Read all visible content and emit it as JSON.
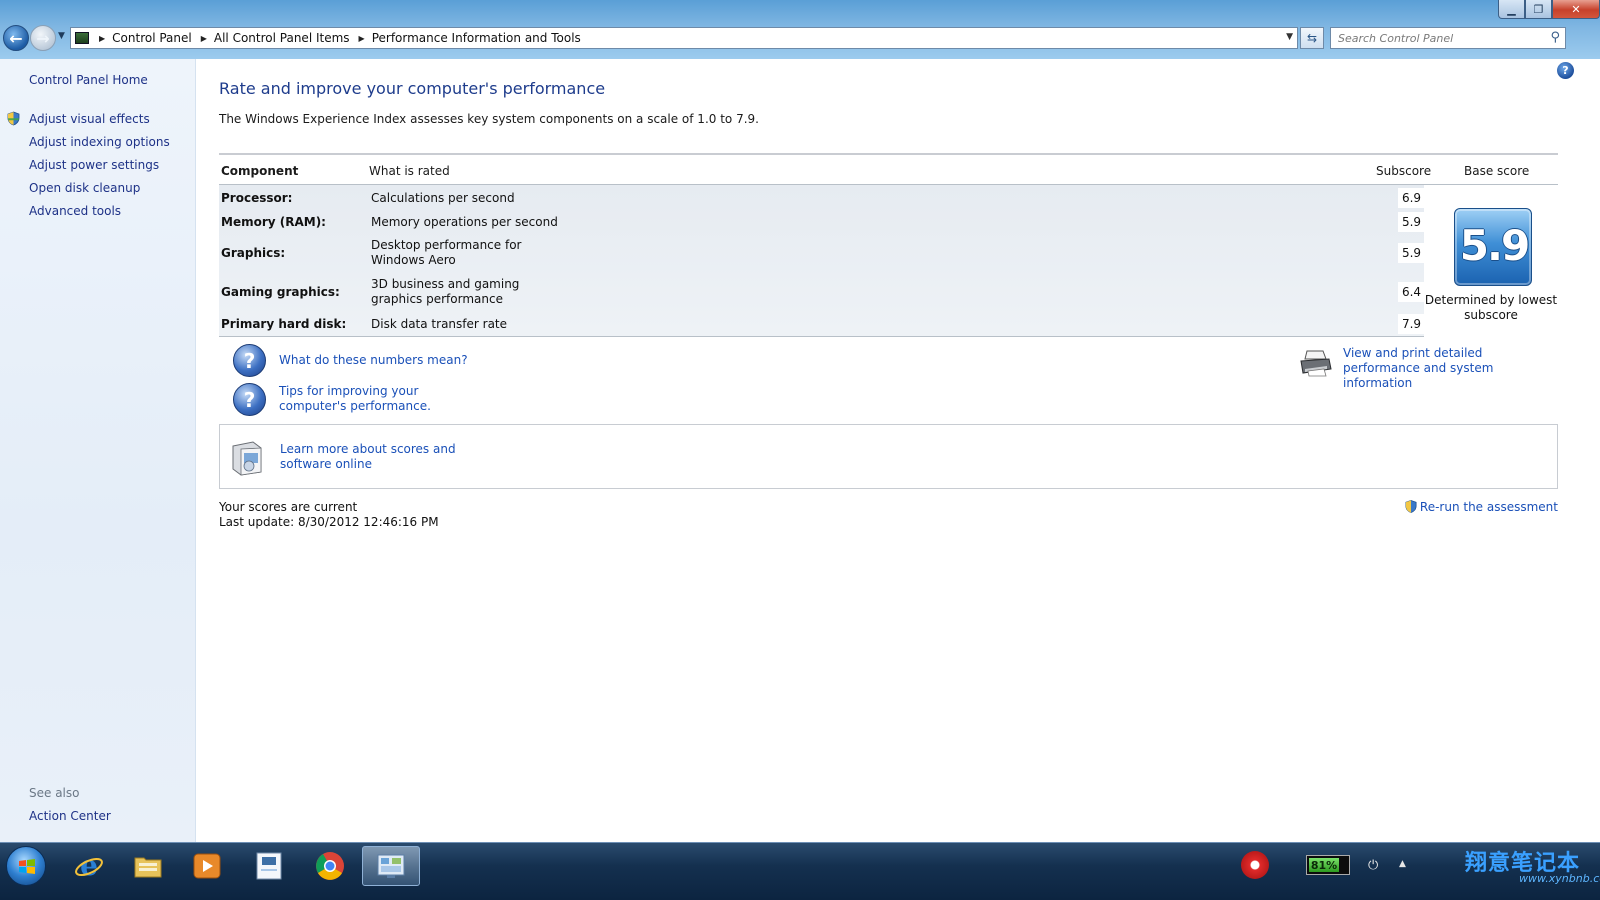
{
  "window": {
    "controls": {
      "minimize": "▁",
      "maximize": "❐",
      "close": "✕"
    }
  },
  "address": {
    "breadcrumbs": [
      "Control Panel",
      "All Control Panel Items",
      "Performance Information and Tools"
    ],
    "search_placeholder": "Search Control Panel"
  },
  "sidebar": {
    "home": "Control Panel Home",
    "tasks": [
      {
        "label": "Adjust visual effects",
        "icon": "shield-icon"
      },
      {
        "label": "Adjust indexing options"
      },
      {
        "label": "Adjust power settings"
      },
      {
        "label": "Open disk cleanup"
      },
      {
        "label": "Advanced tools"
      }
    ],
    "see_also": "See also",
    "see_also_items": [
      "Action Center"
    ]
  },
  "main": {
    "title": "Rate and improve your computer's performance",
    "description": "The Windows Experience Index assesses key system components on a scale of 1.0 to 7.9.",
    "table": {
      "headers": {
        "component": "Component",
        "what": "What is rated",
        "subscore": "Subscore",
        "base": "Base score"
      },
      "rows": [
        {
          "component": "Processor:",
          "what": "Calculations per second",
          "subscore": "6.9"
        },
        {
          "component": "Memory (RAM):",
          "what": "Memory operations per second",
          "subscore": "5.9"
        },
        {
          "component": "Graphics:",
          "what": "Desktop performance for Windows Aero",
          "subscore": "5.9"
        },
        {
          "component": "Gaming graphics:",
          "what": "3D business and gaming graphics performance",
          "subscore": "6.4"
        },
        {
          "component": "Primary hard disk:",
          "what": "Disk data transfer rate",
          "subscore": "7.9"
        }
      ],
      "base_score": "5.9",
      "base_caption": "Determined by lowest subscore"
    },
    "links": {
      "numbers": "What do these numbers mean?",
      "tips": "Tips for improving your computer's performance.",
      "print": "View and print detailed performance and system information",
      "learn": "Learn more about scores and software online"
    },
    "status": {
      "current": "Your scores are current",
      "last_update": "Last update: 8/30/2012 12:46:16 PM",
      "rerun": "Re-run the assessment"
    }
  },
  "taskbar": {
    "apps": [
      {
        "name": "internet-explorer",
        "color": "#2a7fd4"
      },
      {
        "name": "windows-explorer",
        "color": "#e7c35a"
      },
      {
        "name": "media-player",
        "color": "#e8892a"
      },
      {
        "name": "notepad-app",
        "color": "#a9c7e8"
      },
      {
        "name": "chrome",
        "color": "#db4437"
      },
      {
        "name": "control-panel",
        "color": "#6aa3d8"
      }
    ],
    "battery": "81%",
    "watermark_brand": "翔意笔记本",
    "watermark_url": "www.xynbnb.com"
  }
}
